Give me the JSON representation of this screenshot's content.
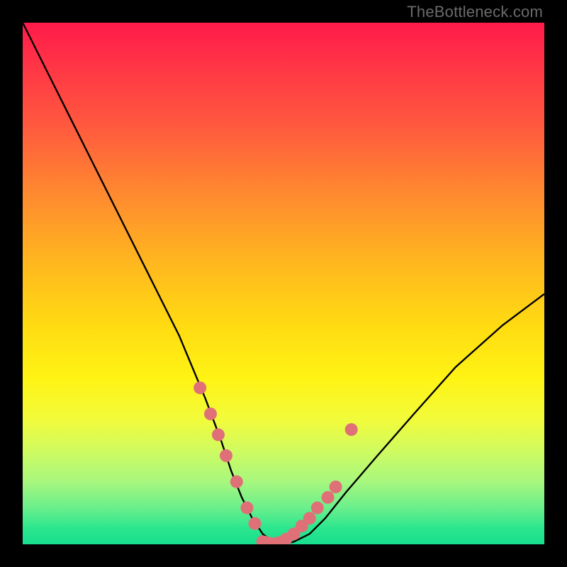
{
  "watermark": "TheBottleneck.com",
  "chart_data": {
    "type": "line",
    "title": "",
    "xlabel": "",
    "ylabel": "",
    "xlim": [
      0,
      100
    ],
    "ylim": [
      0,
      100
    ],
    "grid": false,
    "series": [
      {
        "name": "bottleneck-curve",
        "x": [
          0,
          5,
          10,
          15,
          20,
          25,
          30,
          35,
          38,
          40,
          42,
          44,
          46,
          48,
          50,
          52,
          55,
          58,
          62,
          68,
          75,
          83,
          92,
          100
        ],
        "y": [
          100,
          90,
          80,
          70,
          60,
          50,
          40,
          28,
          20,
          14,
          9,
          5,
          2,
          0.5,
          0,
          0.5,
          2,
          5,
          10,
          17,
          25,
          34,
          42,
          48
        ]
      }
    ],
    "markers": {
      "name": "highlight-points",
      "color": "#e07078",
      "x_left": [
        34,
        36,
        37.5,
        39,
        41,
        43,
        44.5
      ],
      "y_left": [
        30,
        25,
        21,
        17,
        12,
        7,
        4
      ],
      "x_right": [
        50.5,
        52,
        53.5,
        55,
        56.5,
        58.5,
        60,
        63
      ],
      "y_right": [
        1,
        2,
        3.5,
        5,
        7,
        9,
        11,
        22
      ],
      "plateau_x": [
        46,
        48,
        50
      ],
      "plateau_y": [
        0.5,
        0,
        0.5
      ]
    },
    "background_gradient": {
      "top": "#ff1a4a",
      "mid1": "#ff8a2f",
      "mid2": "#fff314",
      "bottom": "#18df8e"
    }
  }
}
